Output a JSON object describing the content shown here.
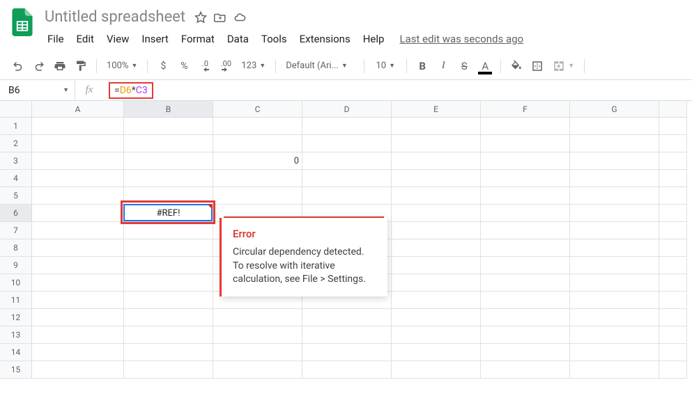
{
  "doc": {
    "title": "Untitled spreadsheet"
  },
  "menubar": {
    "file": "File",
    "edit": "Edit",
    "view": "View",
    "insert": "Insert",
    "format": "Format",
    "data": "Data",
    "tools": "Tools",
    "extensions": "Extensions",
    "help": "Help",
    "last_edit": "Last edit was seconds ago"
  },
  "toolbar": {
    "zoom": "100%",
    "currency": "$",
    "percent": "%",
    "dec_dec": ".0",
    "inc_dec": ".00",
    "more_fmt": "123",
    "font": "Default (Ari...",
    "font_size": "10"
  },
  "formula_bar": {
    "cell_ref": "B6",
    "fx": "fx",
    "formula_eq": "=",
    "formula_r1": "D6",
    "formula_op": "*",
    "formula_r2": "C3"
  },
  "columns": [
    "A",
    "B",
    "C",
    "D",
    "E",
    "F",
    "G"
  ],
  "rows": [
    "1",
    "2",
    "3",
    "4",
    "5",
    "6",
    "7",
    "8",
    "9",
    "10",
    "11",
    "12",
    "13",
    "14",
    "15"
  ],
  "cells": {
    "C3": "0",
    "B6": "#REF!"
  },
  "tooltip": {
    "title": "Error",
    "body": "Circular dependency detected. To resolve with iterative calculation, see File > Settings."
  }
}
